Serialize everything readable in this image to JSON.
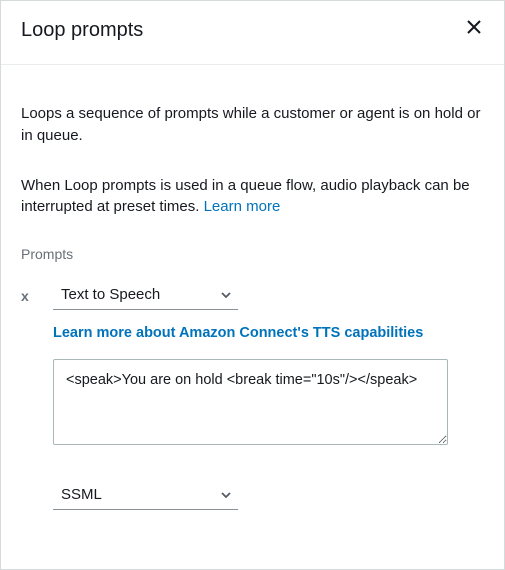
{
  "header": {
    "title": "Loop prompts"
  },
  "description": {
    "para1": "Loops a sequence of prompts while a customer or agent is on hold or in queue.",
    "para2_prefix": "When Loop prompts is used in a queue flow, audio playback can be interrupted at preset times. ",
    "learn_more": "Learn more"
  },
  "prompts": {
    "section_label": "Prompts",
    "remove_label": "x",
    "type_select": {
      "value": "Text to Speech"
    },
    "tts_link": "Learn more about Amazon Connect's TTS capabilities",
    "textarea_value": "<speak>You are on hold <break time=\"10s\"/></speak>",
    "interpret_select": {
      "value": "SSML"
    }
  }
}
